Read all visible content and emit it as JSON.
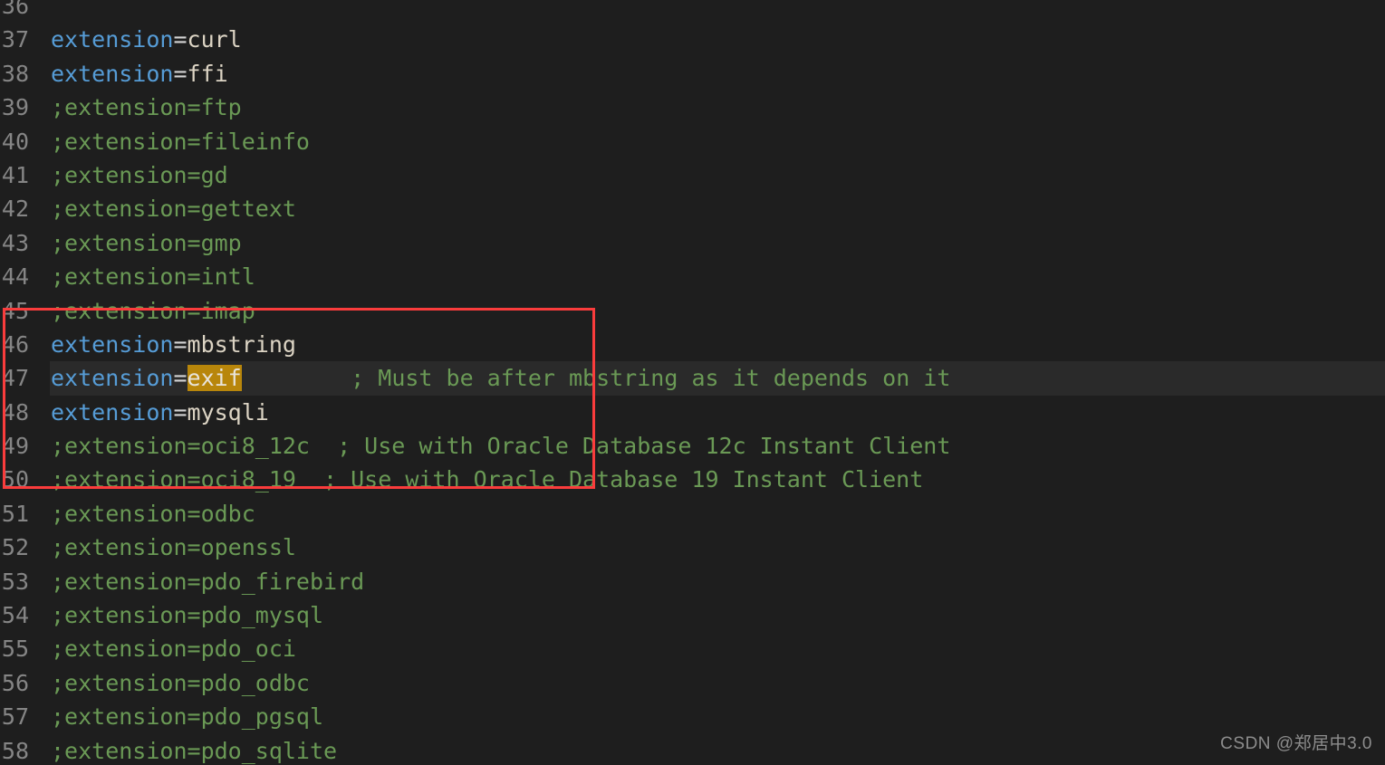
{
  "editor": {
    "file_type": "php.ini",
    "theme": "dark",
    "background_color": "#1e1e1e",
    "current_line_color": "#2a2a2a",
    "selection_color": "#b8860b",
    "syntax_colors": {
      "key": "#569cd6",
      "equals": "#d4d4d4",
      "value": "#dcd4c4",
      "comment": "#6a9955",
      "line_number": "#858585"
    }
  },
  "annotation": {
    "shape": "rectangle",
    "color": "#fa3c3c",
    "covers_lines": "45-50"
  },
  "watermark": {
    "text": "CSDN @郑居中3.0"
  },
  "lines": [
    {
      "number": "36",
      "current": false,
      "tokens": []
    },
    {
      "number": "37",
      "current": false,
      "tokens": [
        {
          "type": "key",
          "text": "extension"
        },
        {
          "type": "eq",
          "text": "="
        },
        {
          "type": "val",
          "text": "curl"
        }
      ]
    },
    {
      "number": "38",
      "current": false,
      "tokens": [
        {
          "type": "key",
          "text": "extension"
        },
        {
          "type": "eq",
          "text": "="
        },
        {
          "type": "val",
          "text": "ffi"
        }
      ]
    },
    {
      "number": "39",
      "current": false,
      "tokens": [
        {
          "type": "comment",
          "text": ";extension=ftp"
        }
      ]
    },
    {
      "number": "40",
      "current": false,
      "tokens": [
        {
          "type": "comment",
          "text": ";extension=fileinfo"
        }
      ]
    },
    {
      "number": "41",
      "current": false,
      "tokens": [
        {
          "type": "comment",
          "text": ";extension=gd"
        }
      ]
    },
    {
      "number": "42",
      "current": false,
      "tokens": [
        {
          "type": "comment",
          "text": ";extension=gettext"
        }
      ]
    },
    {
      "number": "43",
      "current": false,
      "tokens": [
        {
          "type": "comment",
          "text": ";extension=gmp"
        }
      ]
    },
    {
      "number": "44",
      "current": false,
      "tokens": [
        {
          "type": "comment",
          "text": ";extension=intl"
        }
      ]
    },
    {
      "number": "45",
      "current": false,
      "tokens": [
        {
          "type": "comment",
          "text": ";extension=imap"
        }
      ]
    },
    {
      "number": "46",
      "current": false,
      "tokens": [
        {
          "type": "key",
          "text": "extension"
        },
        {
          "type": "eq",
          "text": "="
        },
        {
          "type": "val",
          "text": "mbstring"
        }
      ]
    },
    {
      "number": "47",
      "current": true,
      "tokens": [
        {
          "type": "key",
          "text": "extension"
        },
        {
          "type": "eq",
          "text": "="
        },
        {
          "type": "sel",
          "text": "exif"
        },
        {
          "type": "comment",
          "text": "        ; Must be after mbstring as it depends on it"
        }
      ]
    },
    {
      "number": "48",
      "current": false,
      "tokens": [
        {
          "type": "key",
          "text": "extension"
        },
        {
          "type": "eq",
          "text": "="
        },
        {
          "type": "val",
          "text": "mysqli"
        }
      ]
    },
    {
      "number": "49",
      "current": false,
      "tokens": [
        {
          "type": "comment",
          "text": ";extension=oci8_12c  ; Use with Oracle Database 12c Instant Client"
        }
      ]
    },
    {
      "number": "50",
      "current": false,
      "tokens": [
        {
          "type": "comment",
          "text": ";extension=oci8_19  ; Use with Oracle Database 19 Instant Client"
        }
      ]
    },
    {
      "number": "51",
      "current": false,
      "tokens": [
        {
          "type": "comment",
          "text": ";extension=odbc"
        }
      ]
    },
    {
      "number": "52",
      "current": false,
      "tokens": [
        {
          "type": "comment",
          "text": ";extension=openssl"
        }
      ]
    },
    {
      "number": "53",
      "current": false,
      "tokens": [
        {
          "type": "comment",
          "text": ";extension=pdo_firebird"
        }
      ]
    },
    {
      "number": "54",
      "current": false,
      "tokens": [
        {
          "type": "comment",
          "text": ";extension=pdo_mysql"
        }
      ]
    },
    {
      "number": "55",
      "current": false,
      "tokens": [
        {
          "type": "comment",
          "text": ";extension=pdo_oci"
        }
      ]
    },
    {
      "number": "56",
      "current": false,
      "tokens": [
        {
          "type": "comment",
          "text": ";extension=pdo_odbc"
        }
      ]
    },
    {
      "number": "57",
      "current": false,
      "tokens": [
        {
          "type": "comment",
          "text": ";extension=pdo_pgsql"
        }
      ]
    },
    {
      "number": "58",
      "current": false,
      "tokens": [
        {
          "type": "comment",
          "text": ";extension=pdo_sqlite"
        }
      ]
    }
  ]
}
